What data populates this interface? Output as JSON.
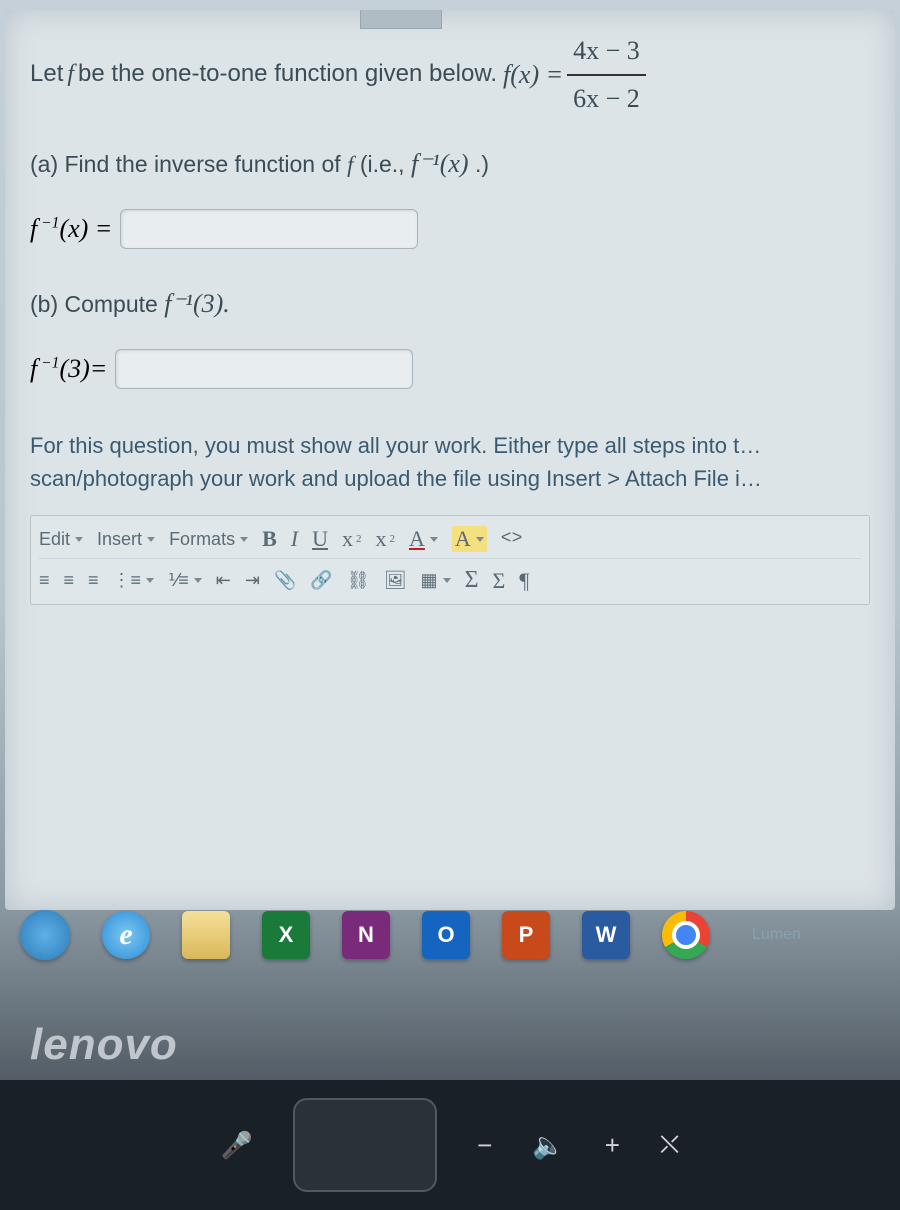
{
  "question": {
    "prompt_prefix": "Let ",
    "prompt_mid": " be the one-to-one function given below. ",
    "func_lhs": "f(x) = ",
    "frac_num": "4x − 3",
    "frac_den": "6x − 2",
    "part_a": "(a) Find the inverse function of ",
    "part_a_tail": " (i.e., ",
    "part_a_math": "f⁻¹(x)",
    "part_a_close": ".)",
    "ans_a_label": "f⁻¹(x) = ",
    "part_b": "(b) Compute ",
    "part_b_math": "f⁻¹(3).",
    "ans_b_label": "f⁻¹(3)= ",
    "instructions": "For this question, you must show all your work. Either type all steps into t… scan/photograph your work and upload the file using Insert > Attach File i…"
  },
  "toolbar": {
    "edit": "Edit",
    "insert": "Insert",
    "formats": "Formats",
    "bold": "B",
    "italic": "I",
    "underline": "U",
    "sub": "x",
    "sub_s": "2",
    "sup": "x",
    "sup_s": "2",
    "textcolor": "A",
    "bgcolor": "A",
    "code": "<>",
    "attach": "📎",
    "link": "🔗",
    "unlink": "⛓",
    "image": "🖼",
    "table": "▦",
    "bigsigma": "Σ",
    "sigma": "Σ",
    "para": "¶"
  },
  "taskbar": {
    "excel": "X",
    "onenote": "N",
    "outlook": "O",
    "ppt": "P",
    "word": "W",
    "ie": "e",
    "lumen": "Lumen"
  },
  "brand": "lenovo",
  "statusbar": {
    "mic": "🎤",
    "minus": "−",
    "vol": "🔈",
    "plus": "+",
    "person": "⛌"
  }
}
